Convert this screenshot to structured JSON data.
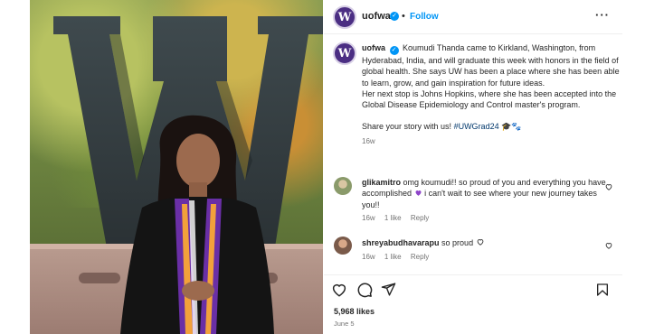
{
  "account": {
    "handle": "uofwa",
    "logo_letter": "W",
    "follow_label": "Follow",
    "separator": "•"
  },
  "caption": {
    "handle": "uofwa",
    "body_1": "Koumudi Thanda came to Kirkland, Washington, from Hyderabad, India, and will graduate this week with honors in the field of global health. She says UW has been a place where she has been able to learn, grow, and gain inspiration for future ideas.",
    "body_2": "Her next stop is Johns Hopkins, where she has been accepted into the Global Disease Epidemiology and Control master's program.",
    "body_3": "Share your story with us!",
    "hashtag": "#UWGrad24",
    "emoji": "🎓🐾",
    "age": "16w"
  },
  "comments": [
    {
      "user": "glikamitro",
      "text_1": "omg koumudi!! so proud of you and everything you have accomplished",
      "text_2": "i can't wait to see where your new journey takes you!!",
      "age": "16w",
      "likes": "1 like",
      "reply": "Reply"
    },
    {
      "user": "shreyabudhavarapu",
      "text_1": "so proud",
      "age": "16w",
      "likes": "1 like",
      "reply": "Reply"
    }
  ],
  "stats": {
    "likes": "5,968 likes",
    "date": "June 5"
  },
  "colors": {
    "brand_purple": "#4b2e83",
    "link_blue": "#0095f6",
    "hashtag_blue": "#00376b",
    "muted": "#737373"
  },
  "icons": {
    "more": "more-horizontal-icon",
    "like": "heart-icon",
    "comment": "comment-bubble-icon",
    "share": "paper-plane-icon",
    "save": "bookmark-icon"
  }
}
